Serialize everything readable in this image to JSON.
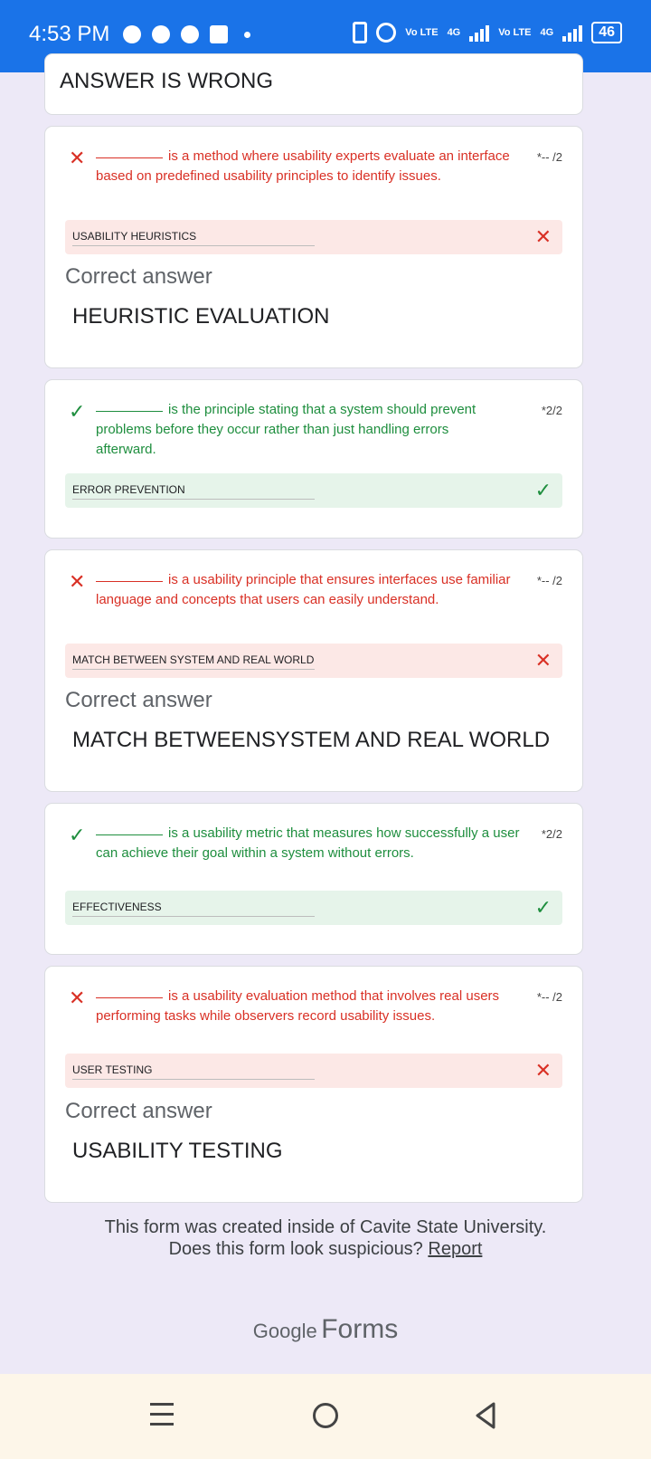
{
  "status_bar": {
    "time": "4:53 PM",
    "net1": "Vo LTE",
    "net1_gen": "4G",
    "net2": "Vo LTE",
    "net2_gen": "4G",
    "battery": "46"
  },
  "top_card": {
    "text": "ANSWER IS WRONG"
  },
  "questions": [
    {
      "status": "wrong",
      "icon": "✕",
      "text": "is a method where usability experts evaluate an interface based on predefined usability principles to identify issues.",
      "score": "*-- /2",
      "answer": "USABILITY HEURISTICS",
      "correct_label": "Correct answer",
      "correct_answer": "HEURISTIC EVALUATION"
    },
    {
      "status": "right",
      "icon": "✓",
      "text": "is the principle stating that a system should prevent problems before they occur rather than just handling errors afterward.",
      "score": "*2/2",
      "answer": "ERROR PREVENTION"
    },
    {
      "status": "wrong",
      "icon": "✕",
      "text": "is a usability principle that ensures interfaces use familiar language and concepts that users can easily understand.",
      "score": "*-- /2",
      "answer": "MATCH BETWEEN SYSTEM AND REAL WORLD",
      "correct_label": "Correct answer",
      "correct_answer": "MATCH BETWEENSYSTEM AND REAL WORLD"
    },
    {
      "status": "right",
      "icon": "✓",
      "text": "is a usability metric that measures how successfully a user can achieve their goal within a system without errors.",
      "score": "*2/2",
      "answer": "EFFECTIVENESS"
    },
    {
      "status": "wrong",
      "icon": "✕",
      "text": "is a usability evaluation method that involves real users performing tasks while observers record usability issues.",
      "score": "*-- /2",
      "answer": "USER TESTING",
      "correct_label": "Correct answer",
      "correct_answer": "USABILITY TESTING"
    }
  ],
  "footer": {
    "line1": "This form was created inside of Cavite State University.",
    "line2": "Does this form look suspicious?",
    "report": "Report",
    "brand_google": "Google",
    "brand_forms": "Forms"
  },
  "colors": {
    "wrong": "#d93025",
    "right": "#1e8e3e",
    "statusbar": "#1a73e8",
    "background": "#ede9f7"
  }
}
